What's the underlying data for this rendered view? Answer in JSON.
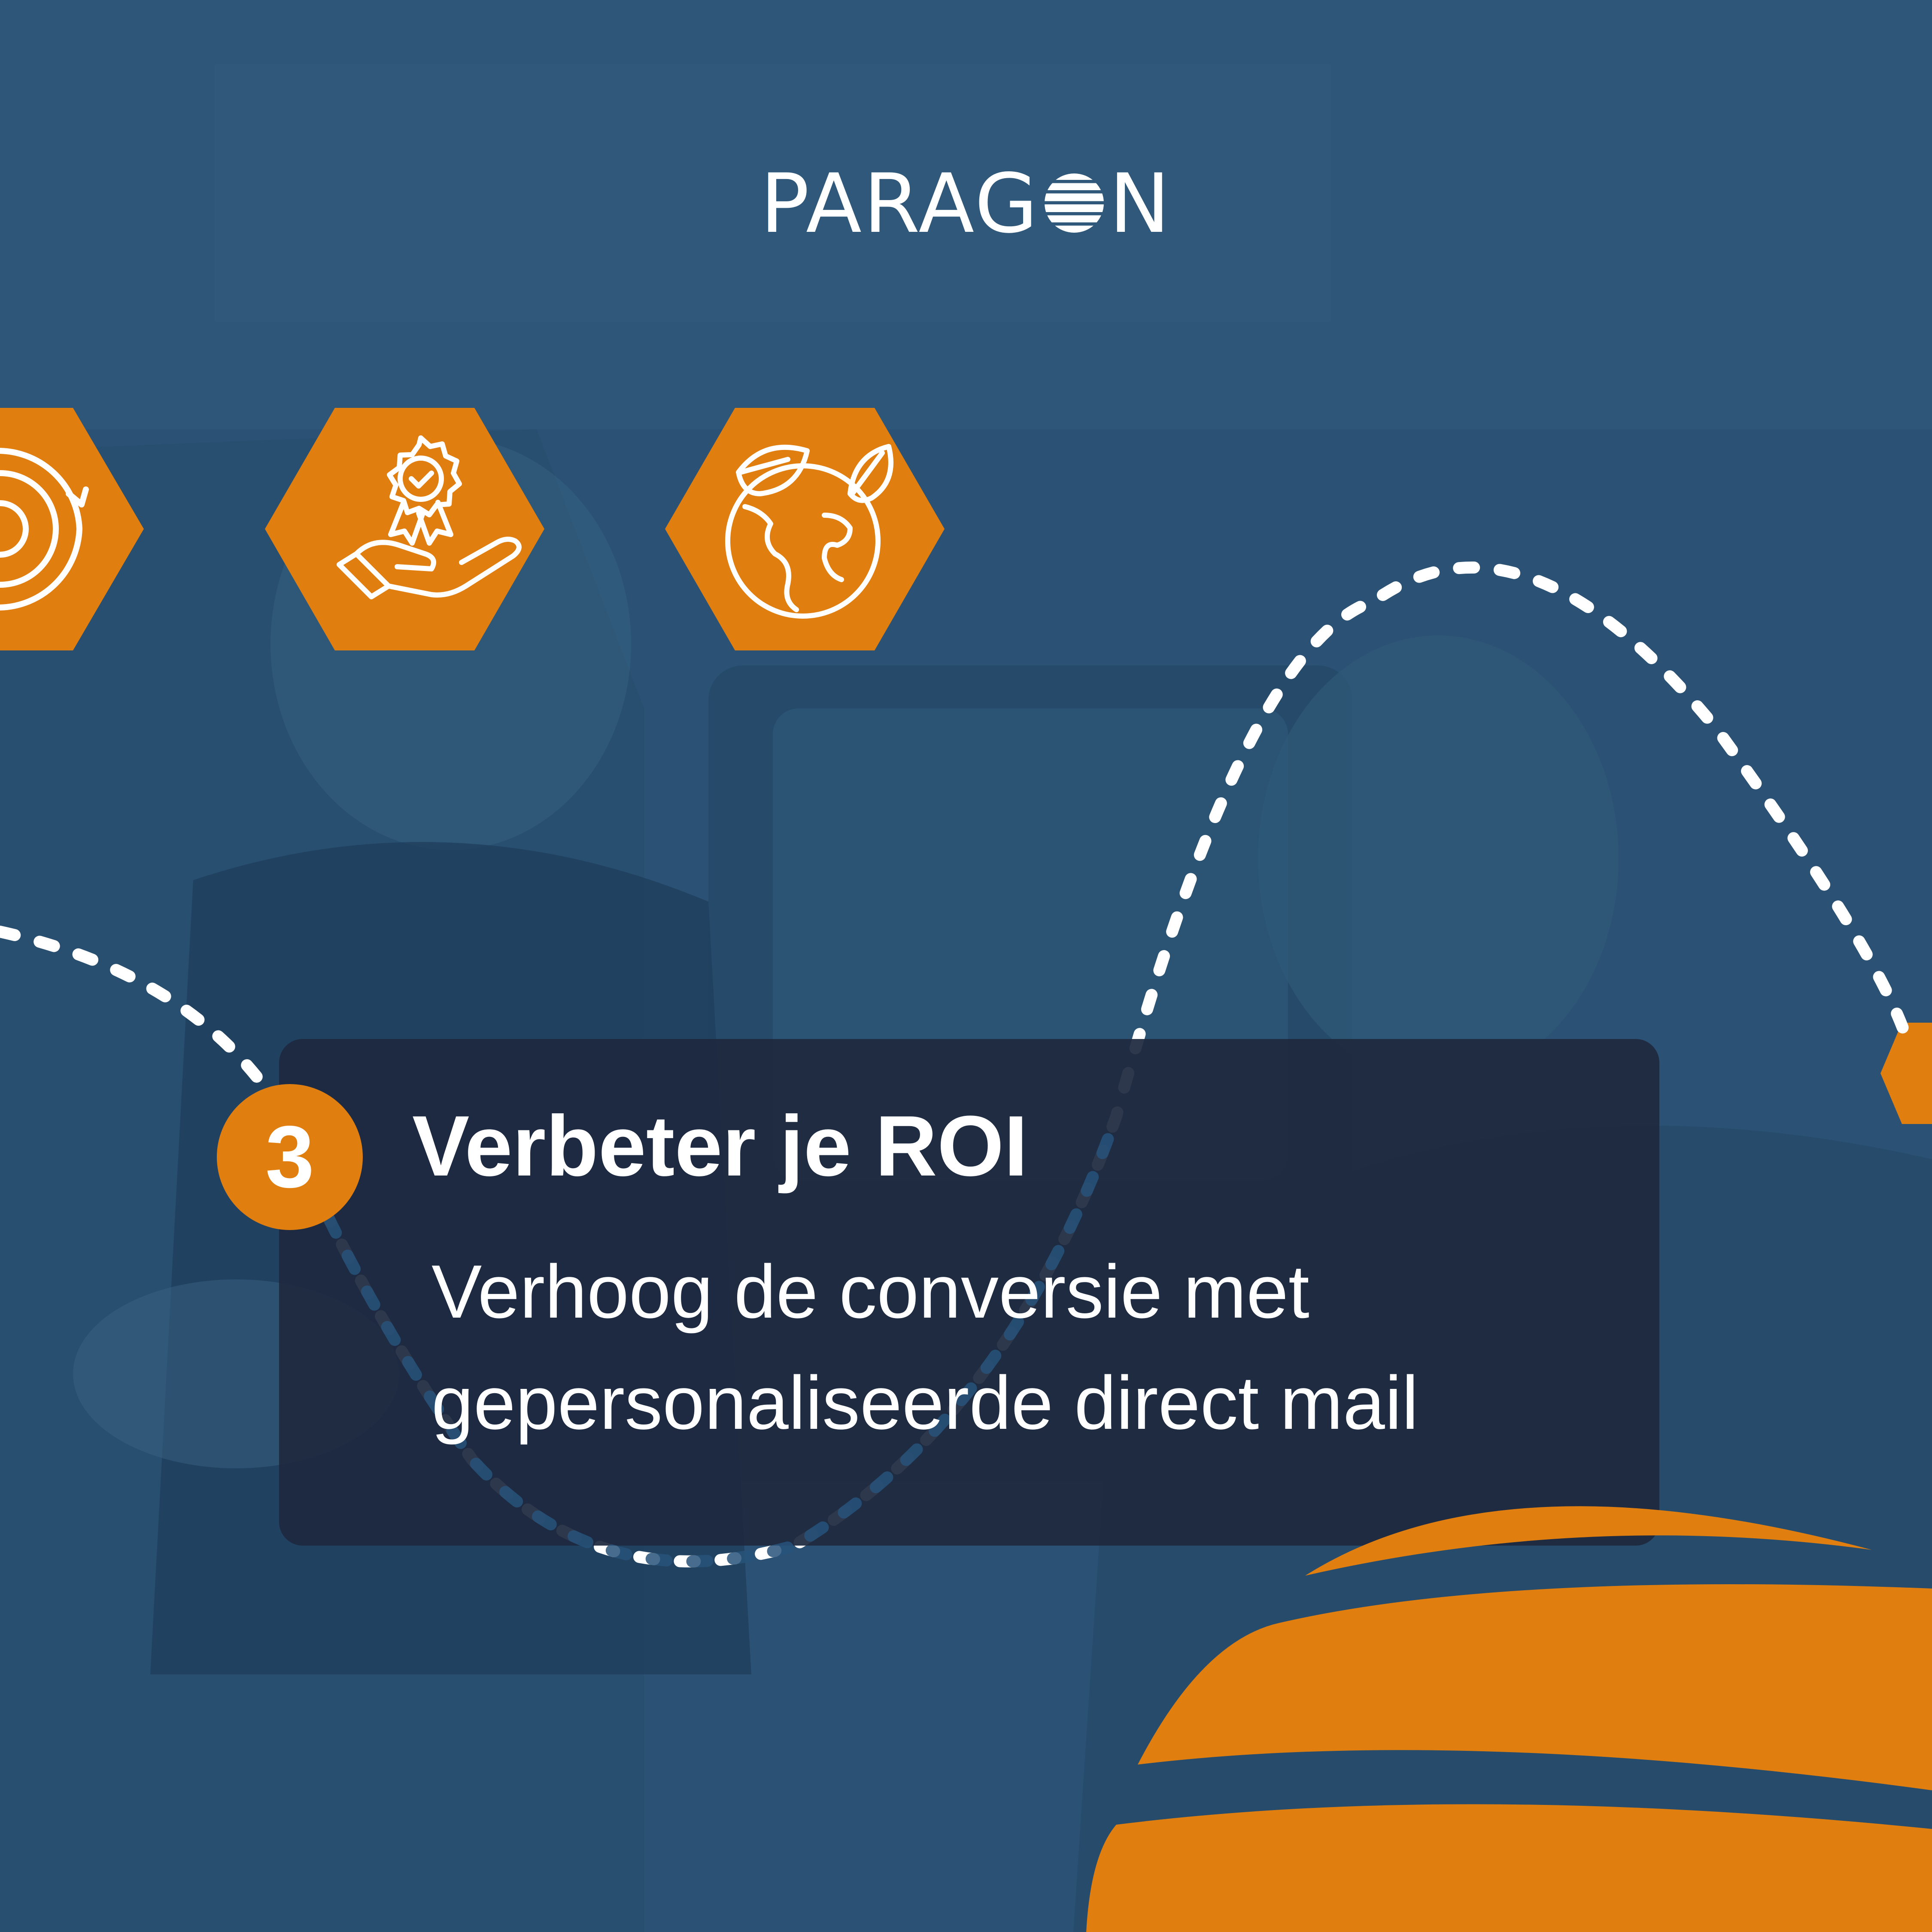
{
  "brand": {
    "name_left": "PARAG",
    "name_right": "N",
    "logo_icon": "globe-stripes-icon"
  },
  "step": {
    "number": "3",
    "title": "Verbeter je ROI",
    "description_lines": [
      "Verhoog de conversie met",
      "gepersonaliseerde direct mail"
    ]
  },
  "icons": [
    {
      "name": "gear-cycle-icon"
    },
    {
      "name": "award-hand-icon"
    },
    {
      "name": "eco-globe-icon"
    },
    {
      "name": "partial-hexagon-icon"
    }
  ],
  "colors": {
    "background": "#2b5275",
    "accent": "#e07f10",
    "card": "#1e293e",
    "text": "#ffffff"
  }
}
